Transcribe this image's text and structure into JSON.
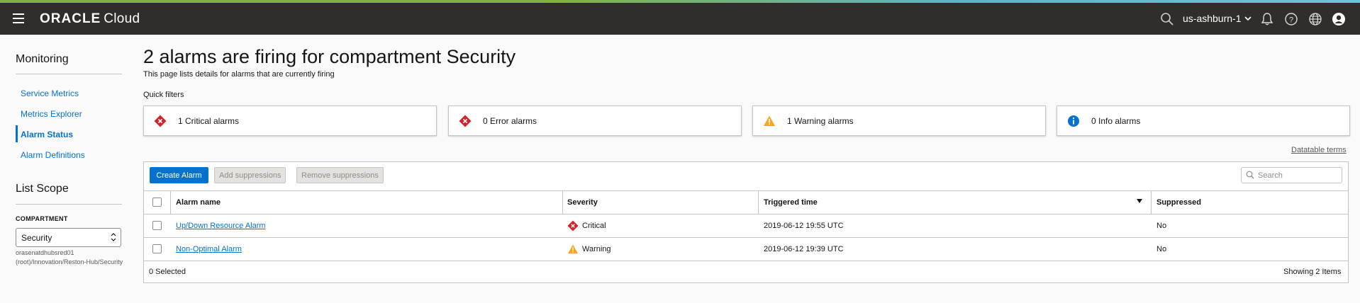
{
  "header": {
    "logo_brand": "ORACLE",
    "logo_product": "Cloud",
    "region": "us-ashburn-1",
    "icons": [
      "menu-icon",
      "search-icon",
      "bell-icon",
      "help-icon",
      "globe-icon",
      "user-icon"
    ]
  },
  "sidebar": {
    "section_title": "Monitoring",
    "items": [
      {
        "label": "Service Metrics",
        "active": false
      },
      {
        "label": "Metrics Explorer",
        "active": false
      },
      {
        "label": "Alarm Status",
        "active": true
      },
      {
        "label": "Alarm Definitions",
        "active": false
      }
    ],
    "scope_title": "List Scope",
    "compartment_label": "COMPARTMENT",
    "compartment_value": "Security",
    "compartment_path": "orasenatdhubsred01 (root)/Innovation/Reston-Hub/Security"
  },
  "main": {
    "title": "2 alarms are firing for compartment Security",
    "subtitle": "This page lists details for alarms that are currently firing",
    "quick_filters_label": "Quick filters",
    "quick_filters": [
      {
        "label": "1 Critical alarms",
        "icon": "critical-icon"
      },
      {
        "label": "0 Error alarms",
        "icon": "error-icon"
      },
      {
        "label": "1 Warning alarms",
        "icon": "warning-icon"
      },
      {
        "label": "0 Info alarms",
        "icon": "info-icon"
      }
    ],
    "datatable_terms": "Datatable terms"
  },
  "toolbar": {
    "create_label": "Create Alarm",
    "add_suppressions_label": "Add suppressions",
    "remove_suppressions_label": "Remove suppressions",
    "search_placeholder": "Search"
  },
  "table": {
    "columns": [
      "Alarm name",
      "Severity",
      "Triggered time",
      "Suppressed"
    ],
    "rows": [
      {
        "name": "Up/Down Resource Alarm",
        "severity": "Critical",
        "triggered": "2019-06-12 19:55 UTC",
        "suppressed": "No"
      },
      {
        "name": "Non-Optimal Alarm",
        "severity": "Warning",
        "triggered": "2019-06-12 19:39 UTC",
        "suppressed": "No"
      }
    ],
    "selected_text": "0 Selected",
    "showing_text": "Showing 2 Items"
  },
  "colors": {
    "header_bg": "#312d2a",
    "link_blue": "#0572ce",
    "critical_red": "#d3222a",
    "warning_orange": "#f5a623"
  }
}
